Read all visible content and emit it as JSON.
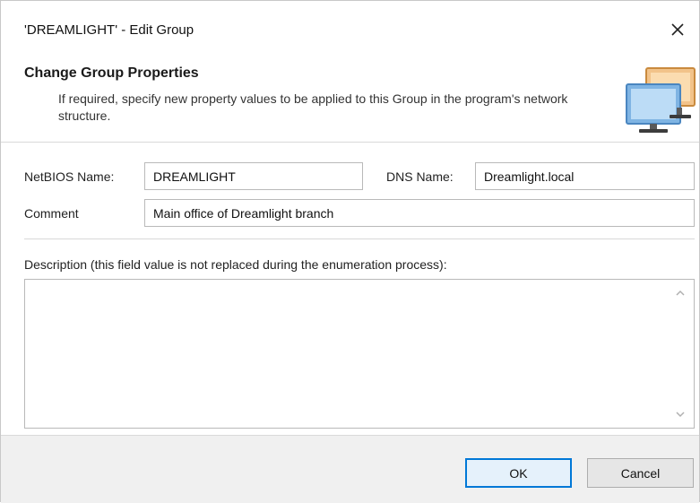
{
  "window": {
    "title": "'DREAMLIGHT' - Edit Group",
    "close_glyph": "✕"
  },
  "header": {
    "title": "Change Group Properties",
    "description": "If required, specify new property values to be applied to this Group in the program's network structure.",
    "icon": "computer-monitors-icon"
  },
  "form": {
    "netbios_label": "NetBIOS Name:",
    "netbios_value": "DREAMLIGHT",
    "dns_label": "DNS Name:",
    "dns_value": "Dreamlight.local",
    "comment_label": "Comment",
    "comment_value": "Main office of Dreamlight branch",
    "description_label": "Description (this field value is not replaced during the enumeration process):",
    "description_value": ""
  },
  "footer": {
    "ok_label": "OK",
    "cancel_label": "Cancel"
  },
  "colors": {
    "accent": "#0078d7",
    "footer_bg": "#f0f0f0",
    "border": "#b9b9b9"
  }
}
